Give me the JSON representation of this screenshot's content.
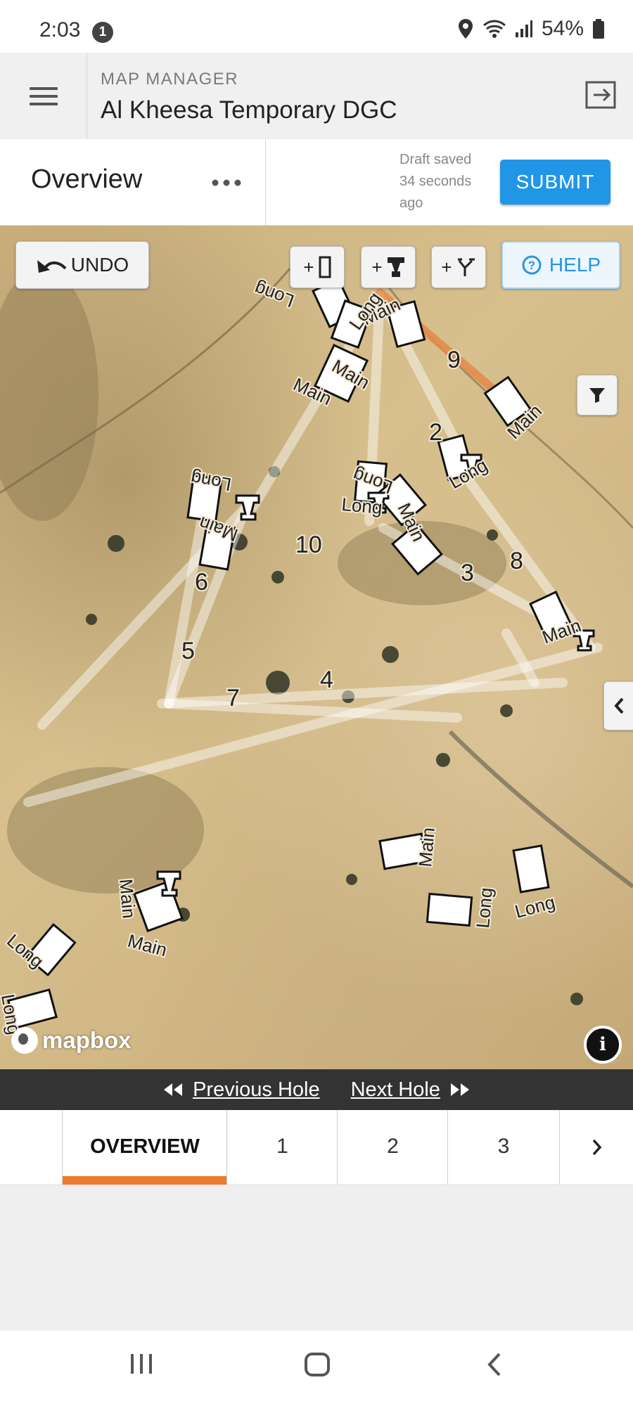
{
  "status_bar": {
    "time": "2:03",
    "notification_count": "1",
    "battery": "54%"
  },
  "header": {
    "kicker": "MAP MANAGER",
    "title": "Al Kheesa Temporary DGC"
  },
  "toolbar": {
    "title": "Overview",
    "draft_status": "Draft saved 34 seconds ago",
    "submit_label": "SUBMIT"
  },
  "map_controls": {
    "undo_label": "UNDO",
    "add_tee_label": "+",
    "add_basket_label": "+",
    "add_path_label": "+",
    "help_label": "HELP",
    "attribution": "mapbox",
    "info_label": "i"
  },
  "map_labels": {
    "hole_numbers": [
      "2",
      "3",
      "4",
      "5",
      "6",
      "7",
      "8",
      "9",
      "10"
    ],
    "main": "Main",
    "long": "Long"
  },
  "hole_nav": {
    "previous": "Previous Hole",
    "next": "Next Hole"
  },
  "tabs": [
    {
      "label": "OVERVIEW",
      "active": true
    },
    {
      "label": "1",
      "active": false
    },
    {
      "label": "2",
      "active": false
    },
    {
      "label": "3",
      "active": false
    }
  ],
  "colors": {
    "accent": "#2196e6",
    "active_tab": "#ee7a2e",
    "hole_nav_bg": "#333333"
  }
}
